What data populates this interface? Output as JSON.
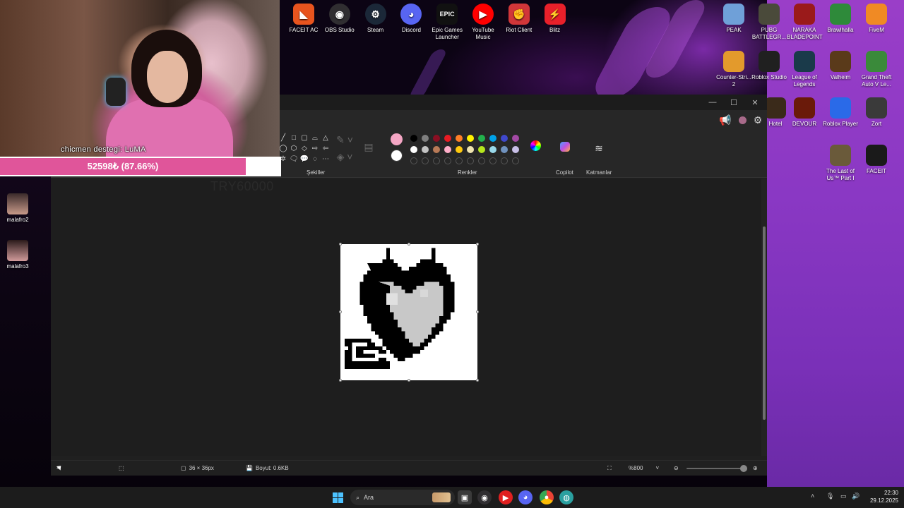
{
  "webcam": {
    "ticker": "chicmen destegi: LuMA"
  },
  "goal": {
    "progress_text": "52598₺ (87.66%)",
    "progress_fraction": 0.8766,
    "target_text": "TRY60000",
    "fill_color": "#e0559a"
  },
  "desktop_left": [
    {
      "label": "malafro2",
      "icon": "avatar-thumb"
    },
    {
      "label": "malafro3",
      "icon": "avatar-thumb"
    }
  ],
  "top_apps": [
    {
      "label": "FACEIT AC",
      "icon": "faceit-ac-icon",
      "color": "#e8541e"
    },
    {
      "label": "OBS Studio",
      "icon": "obs-icon",
      "color": "#302e31"
    },
    {
      "label": "Steam",
      "icon": "steam-icon",
      "color": "#1b2838"
    },
    {
      "label": "Discord",
      "icon": "discord-icon",
      "color": "#5865f2"
    },
    {
      "label": "Epic Games Launcher",
      "icon": "epic-icon",
      "color": "#111111"
    },
    {
      "label": "YouTube Music",
      "icon": "youtube-music-icon",
      "color": "#ff0000"
    },
    {
      "label": "Riot Client",
      "icon": "riot-icon",
      "color": "#d13639"
    },
    {
      "label": "Blitz",
      "icon": "blitz-icon",
      "color": "#e8202a"
    }
  ],
  "right_apps": [
    {
      "label": "PEAK",
      "icon": "peak-icon",
      "color": "#6fa0d8"
    },
    {
      "label": "PUBG BATTLEGR...",
      "icon": "pubg-icon",
      "color": "#4a4a3a"
    },
    {
      "label": "NARAKA BLADEPOINT",
      "icon": "naraka-icon",
      "color": "#9a1a1a"
    },
    {
      "label": "Brawlhalla",
      "icon": "brawlhalla-icon",
      "color": "#2e8a3a"
    },
    {
      "label": "FiveM",
      "icon": "fivem-icon",
      "color": "#f08a24"
    },
    {
      "label": "Counter-Stri... 2",
      "icon": "cs2-icon",
      "color": "#e39a2c"
    },
    {
      "label": "Roblox Studio",
      "icon": "roblox-studio-icon",
      "color": "#202020"
    },
    {
      "label": "League of Legends",
      "icon": "lol-icon",
      "color": "#1a3a4a"
    },
    {
      "label": "Valheim",
      "icon": "valheim-icon",
      "color": "#5a3a1a"
    },
    {
      "label": "Grand Theft Auto V Le...",
      "icon": "gta-icon",
      "color": "#3a8a3a"
    },
    {
      "label": "Hotel",
      "icon": "hotel-icon",
      "color": "#3a2a1a"
    },
    {
      "label": "DEVOUR",
      "icon": "devour-icon",
      "color": "#6a1a0a"
    },
    {
      "label": "Roblox Player",
      "icon": "roblox-player-icon",
      "color": "#2a6ae8"
    },
    {
      "label": "Zort",
      "icon": "zort-icon",
      "color": "#3a3a3a"
    },
    {
      "label": "The Last of Us™ Part I",
      "icon": "tlou-icon",
      "color": "#6a5a3a"
    },
    {
      "label": "FACEIT",
      "icon": "faceit-icon",
      "color": "#1a1a1a"
    }
  ],
  "paint": {
    "ribbon": {
      "shapes_label": "Şekiller",
      "colors_label": "Renkler",
      "copilot_label": "Copilot",
      "layers_label": "Katmanlar",
      "primary_color": "#f4a6c4",
      "secondary_color": "#ffffff",
      "palette_row1": [
        "#000000",
        "#7f7f7f",
        "#8b0f23",
        "#e81b23",
        "#ff7f27",
        "#fff200",
        "#22b14c",
        "#00a2e8",
        "#3f48cc",
        "#a349a4"
      ],
      "palette_row2": [
        "#ffffff",
        "#c3c3c3",
        "#b97a57",
        "#ffaec9",
        "#ffc90e",
        "#efe4b0",
        "#b5e61d",
        "#99d9ea",
        "#7092be",
        "#c8bfe7"
      ]
    },
    "status": {
      "dimensions": "36 × 36px",
      "size": "Boyut: 0.6KB",
      "zoom": "%800"
    }
  },
  "taskbar": {
    "search_placeholder": "Ara",
    "time": "22:30",
    "date": "29.12.2025"
  }
}
